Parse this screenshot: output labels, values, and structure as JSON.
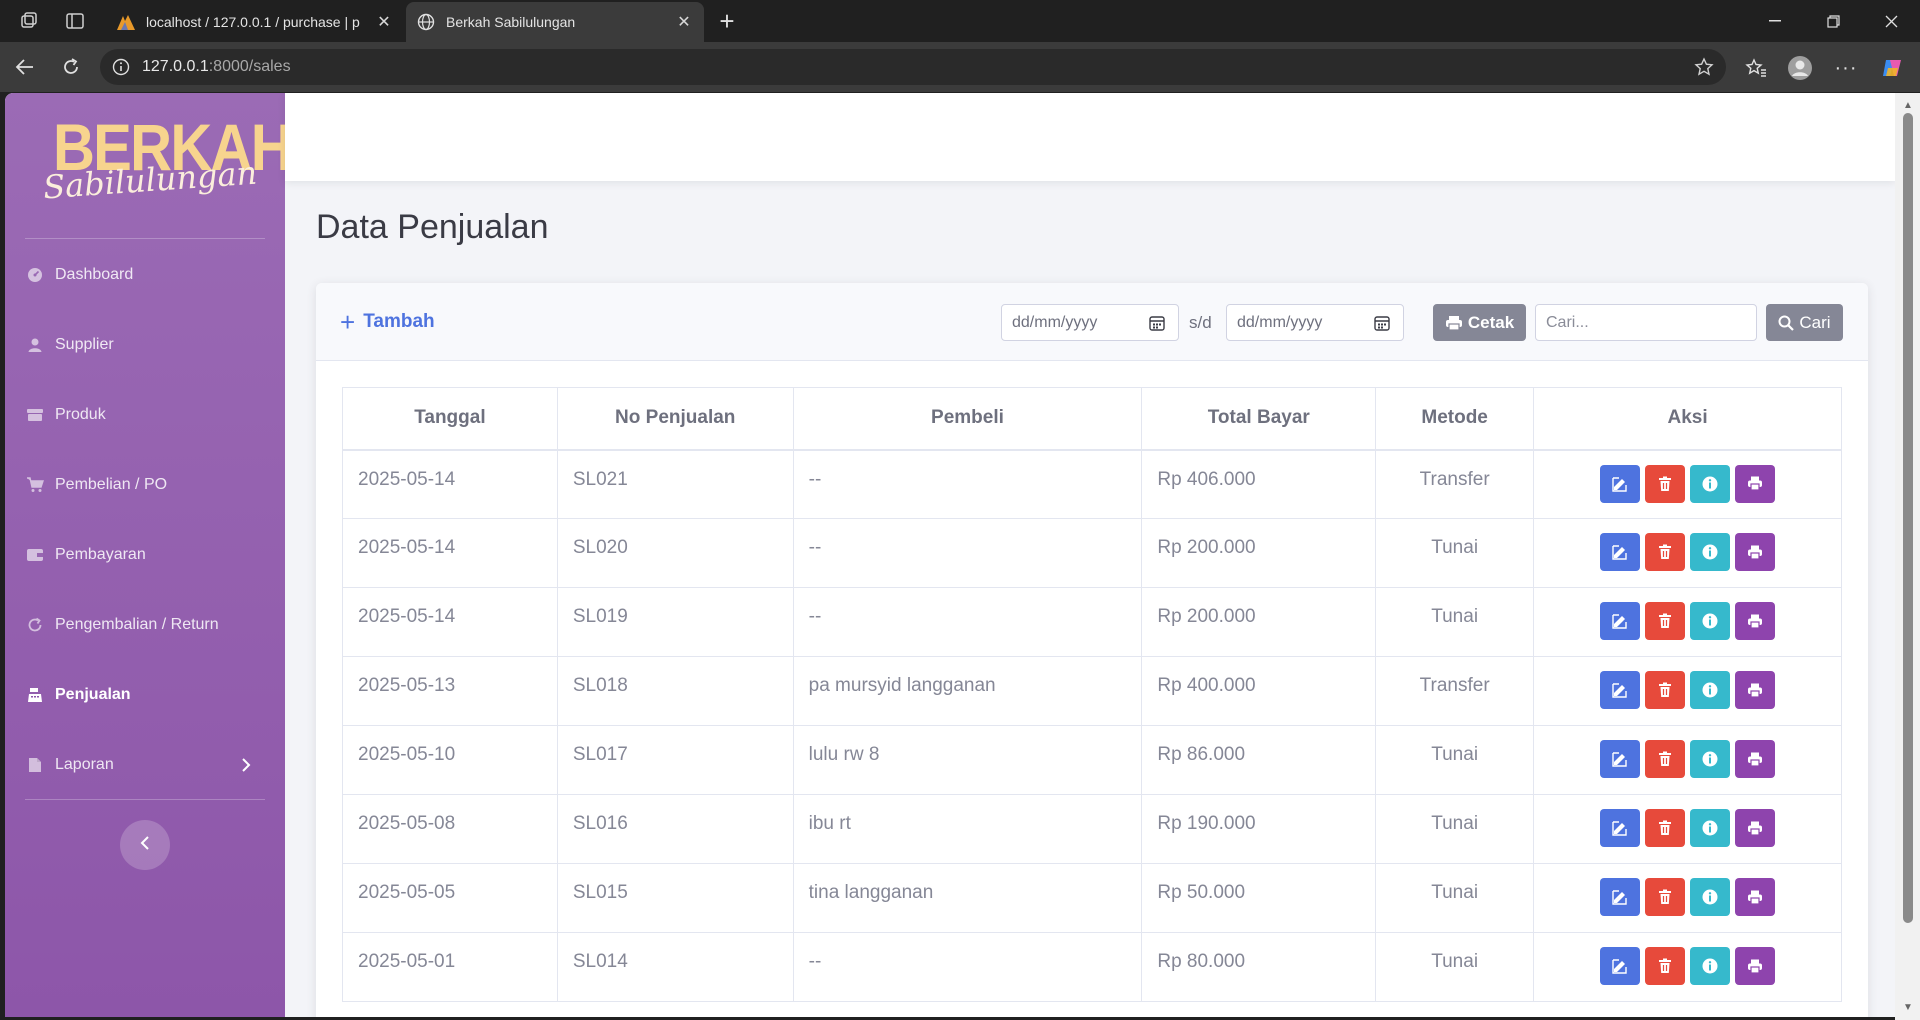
{
  "browser": {
    "tabs": [
      {
        "title": "localhost / 127.0.0.1 / purchase | p",
        "active": false
      },
      {
        "title": "Berkah Sabilulungan",
        "active": true
      }
    ],
    "url_host": "127.0.0.1",
    "url_rest": ":8000/sales"
  },
  "brand": {
    "main": "BERKAH",
    "script": "Sabilulungan"
  },
  "sidebar": {
    "items": [
      {
        "label": "Dashboard",
        "icon": "dashboard-icon"
      },
      {
        "label": "Supplier",
        "icon": "user-icon"
      },
      {
        "label": "Produk",
        "icon": "box-icon"
      },
      {
        "label": "Pembelian / PO",
        "icon": "cart-icon"
      },
      {
        "label": "Pembayaran",
        "icon": "wallet-icon"
      },
      {
        "label": "Pengembalian / Return",
        "icon": "return-icon"
      },
      {
        "label": "Penjualan",
        "icon": "cash-register-icon",
        "active": true
      },
      {
        "label": "Laporan",
        "icon": "file-icon"
      }
    ]
  },
  "page": {
    "title": "Data Penjualan"
  },
  "toolbar": {
    "add_label": "Tambah",
    "date_from_placeholder": "dd/mm/yyyy",
    "date_sep": "s/d",
    "date_to_placeholder": "dd/mm/yyyy",
    "print_label": "Cetak",
    "search_placeholder": "Cari...",
    "search_label": "Cari"
  },
  "table": {
    "headers": [
      "Tanggal",
      "No Penjualan",
      "Pembeli",
      "Total Bayar",
      "Metode",
      "Aksi"
    ],
    "rows": [
      {
        "tanggal": "2025-05-14",
        "no": "SL021",
        "pembeli": "--",
        "total": "Rp 406.000",
        "metode": "Transfer"
      },
      {
        "tanggal": "2025-05-14",
        "no": "SL020",
        "pembeli": "--",
        "total": "Rp 200.000",
        "metode": "Tunai"
      },
      {
        "tanggal": "2025-05-14",
        "no": "SL019",
        "pembeli": "--",
        "total": "Rp 200.000",
        "metode": "Tunai"
      },
      {
        "tanggal": "2025-05-13",
        "no": "SL018",
        "pembeli": "pa mursyid langganan",
        "total": "Rp 400.000",
        "metode": "Transfer"
      },
      {
        "tanggal": "2025-05-10",
        "no": "SL017",
        "pembeli": "lulu rw 8",
        "total": "Rp 86.000",
        "metode": "Tunai"
      },
      {
        "tanggal": "2025-05-08",
        "no": "SL016",
        "pembeli": "ibu rt",
        "total": "Rp 190.000",
        "metode": "Tunai"
      },
      {
        "tanggal": "2025-05-05",
        "no": "SL015",
        "pembeli": "tina langganan",
        "total": "Rp 50.000",
        "metode": "Tunai"
      },
      {
        "tanggal": "2025-05-01",
        "no": "SL014",
        "pembeli": "--",
        "total": "Rp 80.000",
        "metode": "Tunai"
      }
    ]
  },
  "colors": {
    "sidebar": "#9b6bb5",
    "primary": "#4e73df",
    "danger": "#e74a3b",
    "info": "#36b9cc",
    "print": "#8e44ad",
    "secondary": "#858796"
  }
}
